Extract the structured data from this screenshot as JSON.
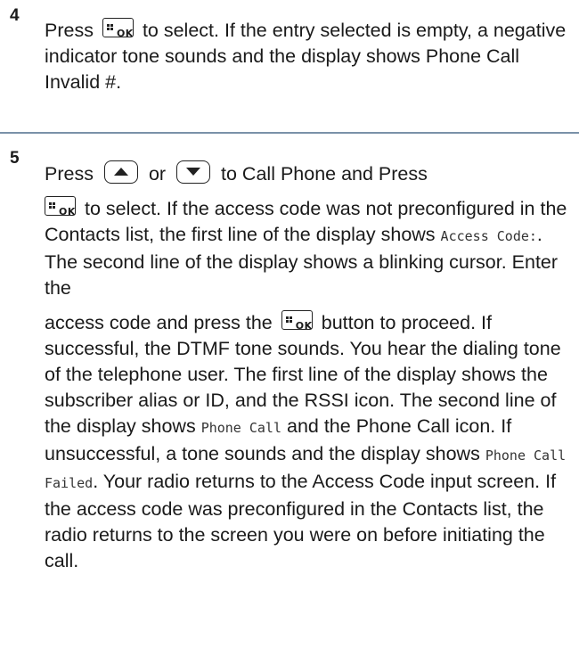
{
  "step4": {
    "number": "4",
    "text_1": "Press",
    "text_2": "to select. If the entry selected is empty, a negative indicator tone sounds and the display shows Phone Call Invalid #."
  },
  "step5": {
    "number": "5",
    "p1_text_1": "Press",
    "p1_text_2": "or",
    "p1_text_3": "to Call Phone and Press",
    "p2_text_1": "to select. If the access code was not preconfigured in the Contacts list, the first line of the display shows",
    "p2_mono_1": "Access Code:",
    "p2_text_2": ". The second line of the display shows a blinking cursor. Enter the",
    "p3_text_1": "access code and press the",
    "p3_text_2": "button to proceed. If successful, the DTMF tone sounds. You hear the dialing tone of the telephone user. The first line of the display shows the subscriber alias or ID, and the RSSI icon. The second line of the display shows",
    "p3_mono_1": "Phone Call",
    "p3_text_3": "and the Phone Call icon. If unsuccessful, a tone sounds and the display shows",
    "p3_mono_2": "Phone Call Failed",
    "p3_text_4": ". Your radio returns to the Access Code input screen. If the access code was preconfigured in the Contacts list, the radio returns to the screen you were on before initiating the call."
  },
  "icons": {
    "ok_key_label": "OK",
    "ok_key": "menu-ok-key-icon",
    "up_key": "up-arrow-key-icon",
    "down_key": "down-arrow-key-icon"
  },
  "colors": {
    "divider": "#7a92a8",
    "text": "#1a1a1a"
  }
}
